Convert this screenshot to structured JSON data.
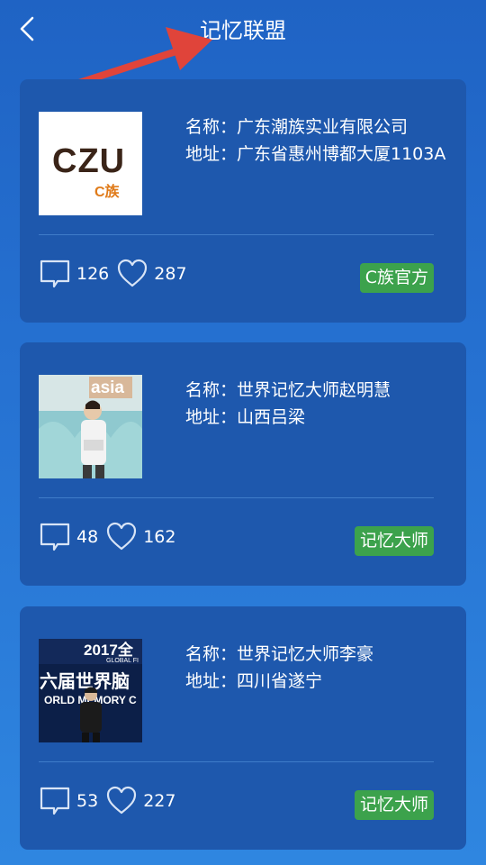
{
  "header": {
    "title": "记忆联盟",
    "back_icon": "chevron-left-icon"
  },
  "cards": [
    {
      "name": "名称：广东潮族实业有限公司",
      "address": "地址：广东省惠州博都大厦1103A",
      "comments": "126",
      "likes": "287",
      "badge": "C族官方",
      "logo": {
        "main": "CZU",
        "sub": "C族"
      }
    },
    {
      "name": "名称：世界记忆大师赵明慧",
      "address": "地址：山西吕梁",
      "comments": "48",
      "likes": "162",
      "badge": "记忆大师",
      "photo": {
        "sign_text": "asia"
      }
    },
    {
      "name": "名称：世界记忆大师李豪",
      "address": "地址：四川省遂宁",
      "comments": "53",
      "likes": "227",
      "badge": "记忆大师",
      "photo": {
        "top_text": "2017全",
        "line1": "六届世界脑",
        "line2": "ORLD MEMORY C",
        "line3": "GLOBAL FI"
      }
    }
  ],
  "colors": {
    "background_top": "#1f63c4",
    "card": "#1e58ad",
    "badge": "#3ca24c",
    "annotation_arrow": "#e0443a"
  }
}
